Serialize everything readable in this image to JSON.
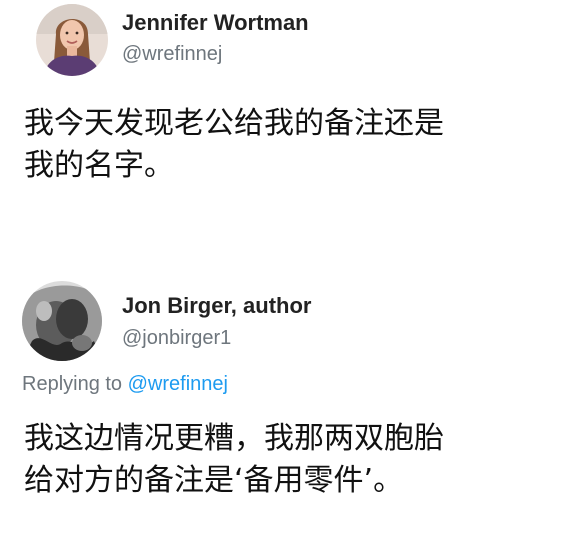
{
  "tweets": [
    {
      "author_name": "Jennifer Wortman",
      "author_handle": "@wrefinnej",
      "text_lines": [
        "我今天发现老公给我的备注还是",
        "我的名字。"
      ]
    },
    {
      "author_name": "Jon Birger, author",
      "author_handle": "@jonbirger1",
      "reply_prefix": "Replying to",
      "reply_mention": "@wrefinnej",
      "text_lines": [
        "我这边情况更糟，我那两双胞胎",
        "给对方的备注是‘备用零件’。"
      ]
    }
  ],
  "colors": {
    "handle_gray": "#6e767d",
    "mention_blue": "#1d9bf0"
  }
}
